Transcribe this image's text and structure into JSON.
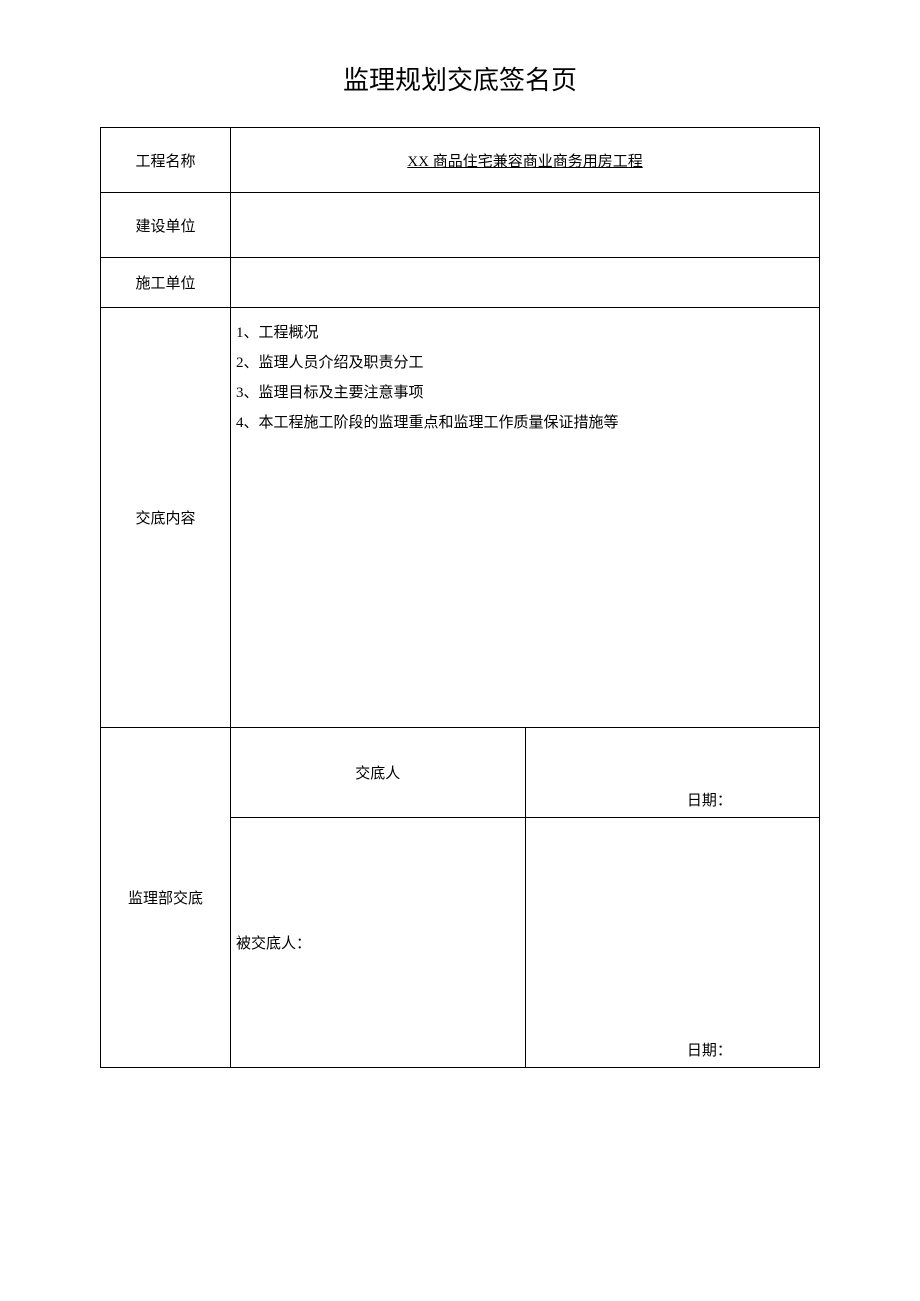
{
  "title": "监理规划交底签名页",
  "rows": {
    "project_name_label": "工程名称",
    "project_name_value": "XX 商品住宅兼容商业商务用房工程",
    "construction_unit_label": "建设单位",
    "construction_unit_value": "",
    "contractor_label": "施工单位",
    "contractor_value": "",
    "content_label": "交底内容",
    "content_lines": {
      "l1": "1、工程概况",
      "l2": "2、监理人员介绍及职责分工",
      "l3": "3、监理目标及主要注意事项",
      "l4": "4、本工程施工阶段的监理重点和监理工作质量保证措施等"
    },
    "supervision_label": "监理部交底",
    "disclosure_person_label": "交底人",
    "received_person_label": "被交底人：",
    "date_label_1": "日期：",
    "date_label_2": "日期："
  }
}
